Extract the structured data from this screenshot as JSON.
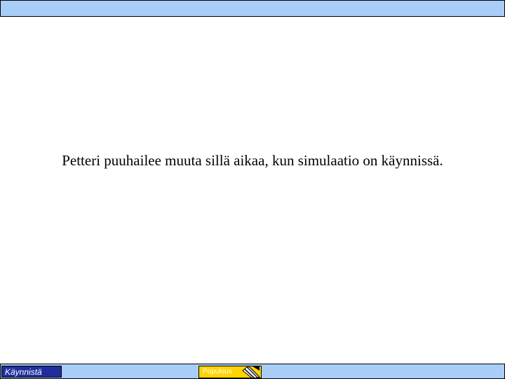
{
  "slide": {
    "caption": "Petteri puuhailee muuta sillä aikaa, kun simulaatio on käynnissä."
  },
  "taskbar": {
    "start_label": "Käynnistä",
    "task_label": "Populous",
    "task_icon": "pencil-icon"
  },
  "colors": {
    "bar_background": "#a8cdf6",
    "start_button": "#1f2e9c",
    "task_button": "#ffd400"
  }
}
